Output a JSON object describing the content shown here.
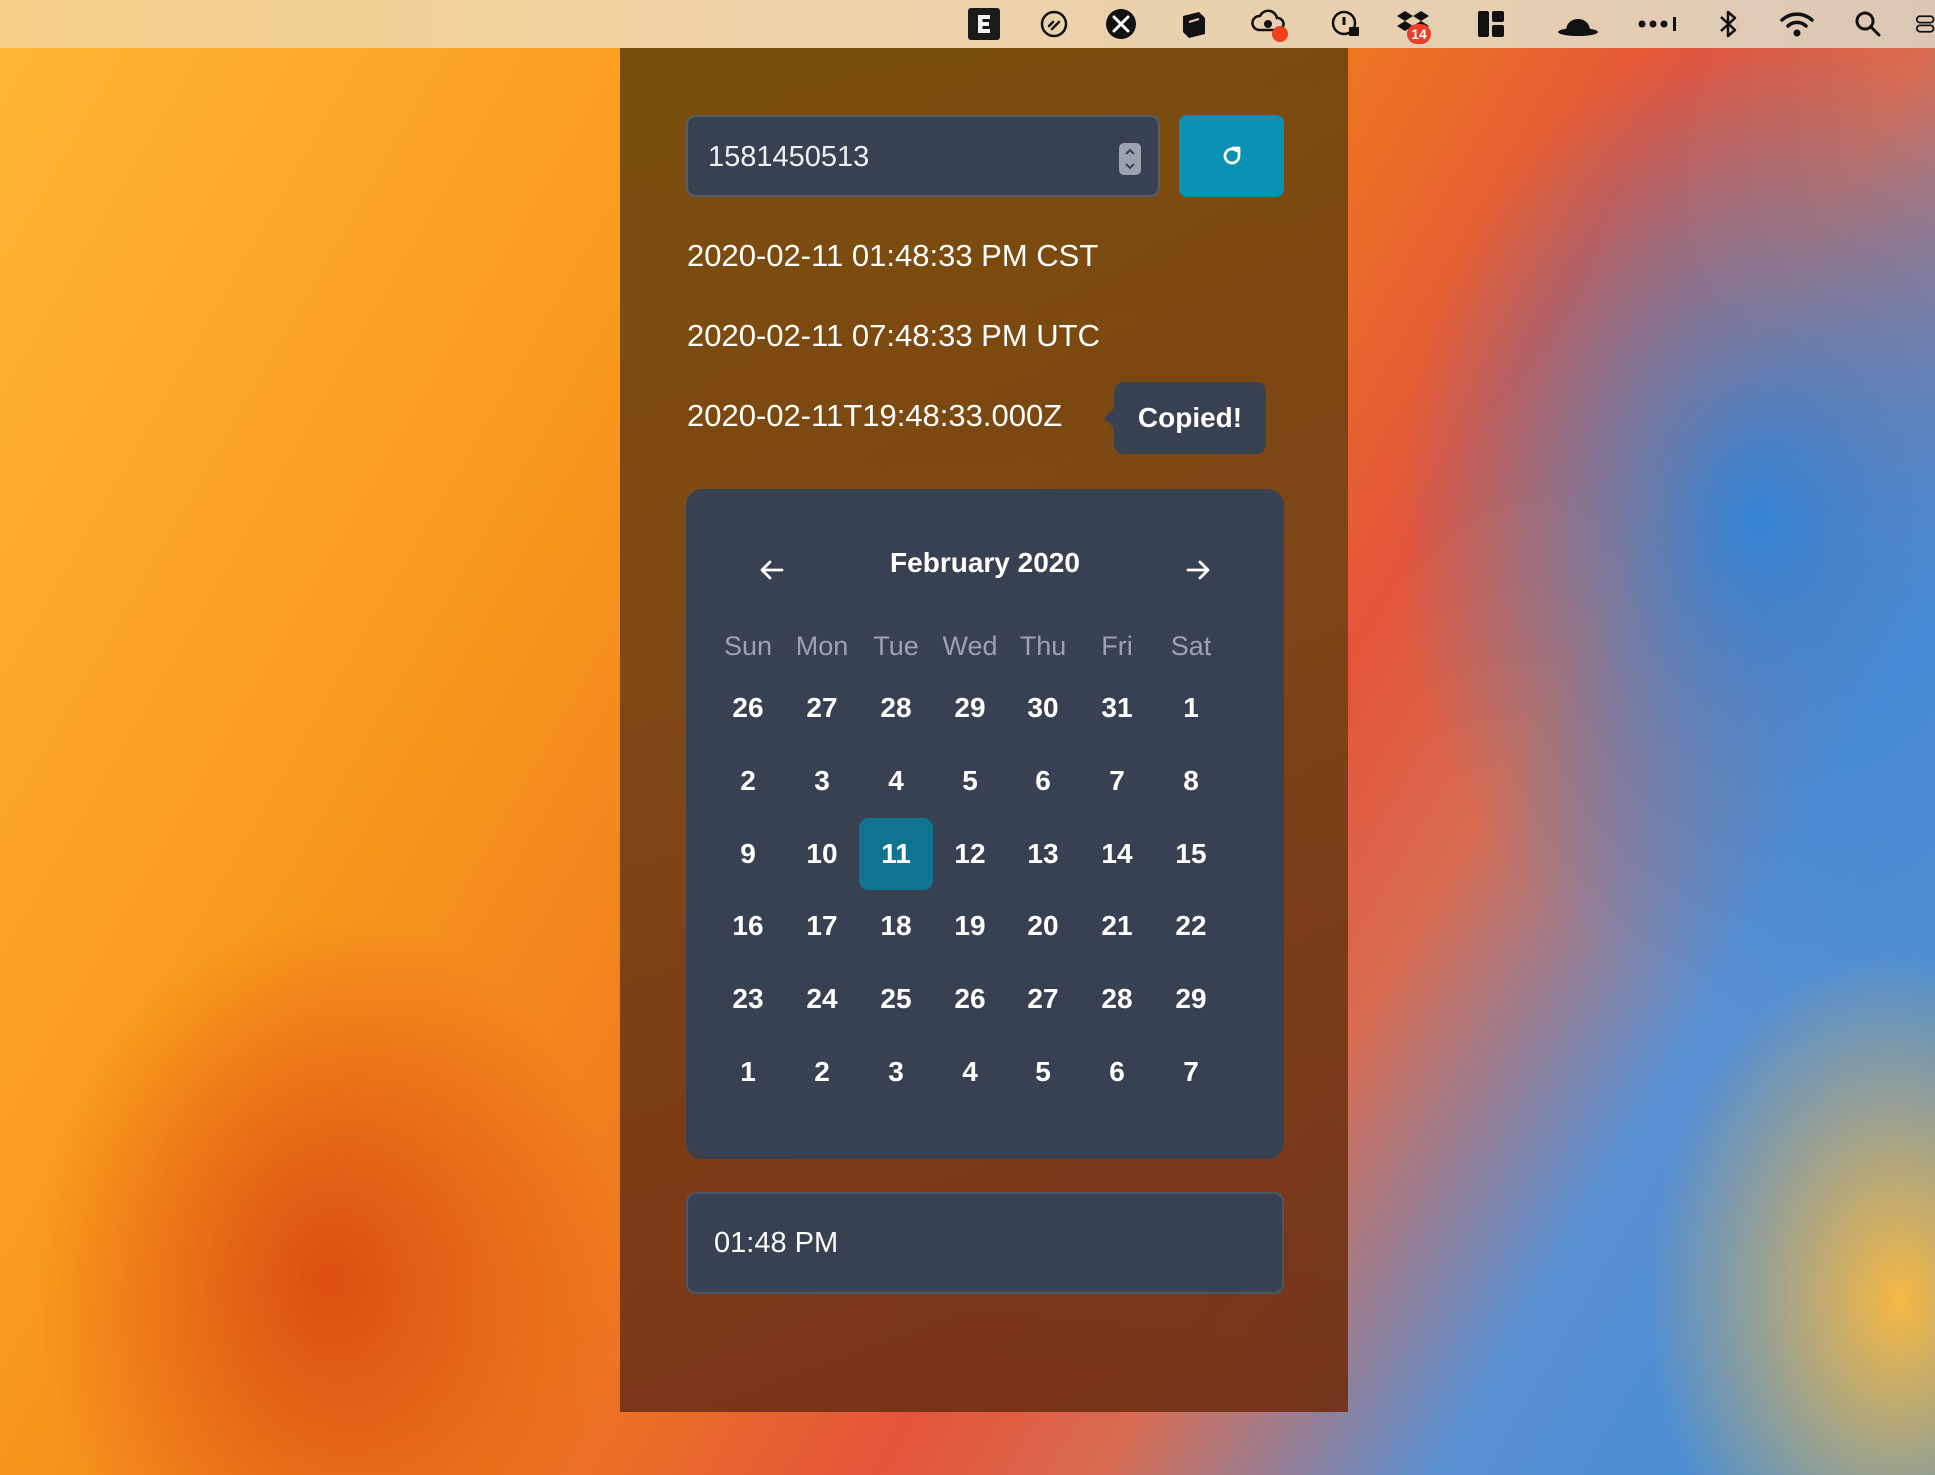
{
  "menubar": {
    "badge_count": "14"
  },
  "app": {
    "timestamp_input": "1581450513",
    "local_time": "2020-02-11 01:48:33 PM CST",
    "utc_time": "2020-02-11 07:48:33 PM UTC",
    "iso_time": "2020-02-11T19:48:33.000Z",
    "tooltip": "Copied!",
    "accent_color": "#0891b2"
  },
  "calendar": {
    "month_label": "February 2020",
    "weekdays": [
      "Sun",
      "Mon",
      "Tue",
      "Wed",
      "Thu",
      "Fri",
      "Sat"
    ],
    "weeks": [
      [
        "26",
        "27",
        "28",
        "29",
        "30",
        "31",
        "1"
      ],
      [
        "2",
        "3",
        "4",
        "5",
        "6",
        "7",
        "8"
      ],
      [
        "9",
        "10",
        "11",
        "12",
        "13",
        "14",
        "15"
      ],
      [
        "16",
        "17",
        "18",
        "19",
        "20",
        "21",
        "22"
      ],
      [
        "23",
        "24",
        "25",
        "26",
        "27",
        "28",
        "29"
      ],
      [
        "1",
        "2",
        "3",
        "4",
        "5",
        "6",
        "7"
      ]
    ],
    "selected_day": "11"
  },
  "time_picker": {
    "value": "01:48 PM"
  }
}
